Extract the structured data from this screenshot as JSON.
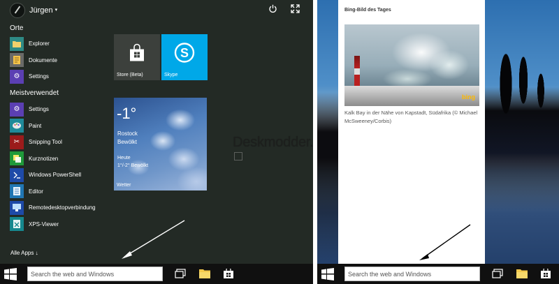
{
  "start_menu": {
    "user_name": "Jürgen",
    "places_heading": "Orte",
    "places": [
      {
        "label": "Explorer",
        "icon": "folder-icon",
        "color": "#2e8a85"
      },
      {
        "label": "Dokumente",
        "icon": "document-icon",
        "color": "#6a6a68"
      },
      {
        "label": "Settings",
        "icon": "gear-icon",
        "color": "#5b3fb3"
      }
    ],
    "most_used_heading": "Meistverwendet",
    "most_used": [
      {
        "label": "Settings",
        "icon": "gear-icon",
        "color": "#5b3fb3"
      },
      {
        "label": "Paint",
        "icon": "palette-icon",
        "color": "#1f8a99"
      },
      {
        "label": "Snipping Tool",
        "icon": "scissors-icon",
        "color": "#9b1b1b"
      },
      {
        "label": "Kurznotizen",
        "icon": "sticky-note-icon",
        "color": "#1f9a3a"
      },
      {
        "label": "Windows PowerShell",
        "icon": "terminal-icon",
        "color": "#1e4aa8"
      },
      {
        "label": "Editor",
        "icon": "notepad-icon",
        "color": "#2176b3"
      },
      {
        "label": "Remotedesktopverbindung",
        "icon": "remote-desktop-icon",
        "color": "#1e4aa8"
      },
      {
        "label": "XPS-Viewer",
        "icon": "xps-icon",
        "color": "#16888e"
      }
    ],
    "all_apps": "Alle Apps ↓",
    "tiles": {
      "store_label": "Store (Beta)",
      "skype_label": "Skype",
      "weather": {
        "temperature": "-1°",
        "city": "Rostock",
        "condition": "Bewölkt",
        "today": "Heute",
        "forecast": "1°/-2° Bewölkt",
        "app_label": "Wetter"
      }
    }
  },
  "watermark": "Deskmodder.de",
  "taskbar": {
    "search_placeholder": "Search the web and Windows"
  },
  "bing_panel": {
    "title": "Bing-Bild des Tages",
    "logo_text": "bing",
    "caption": "Kalk Bay in der Nähe von Kapstadt, Südafrika (© Michael McSweeney/Corbis)"
  },
  "colors": {
    "start_bg": "#232a25",
    "skype_tile": "#00a8e8",
    "store_tile": "#3c403c",
    "taskbar": "#101010"
  }
}
